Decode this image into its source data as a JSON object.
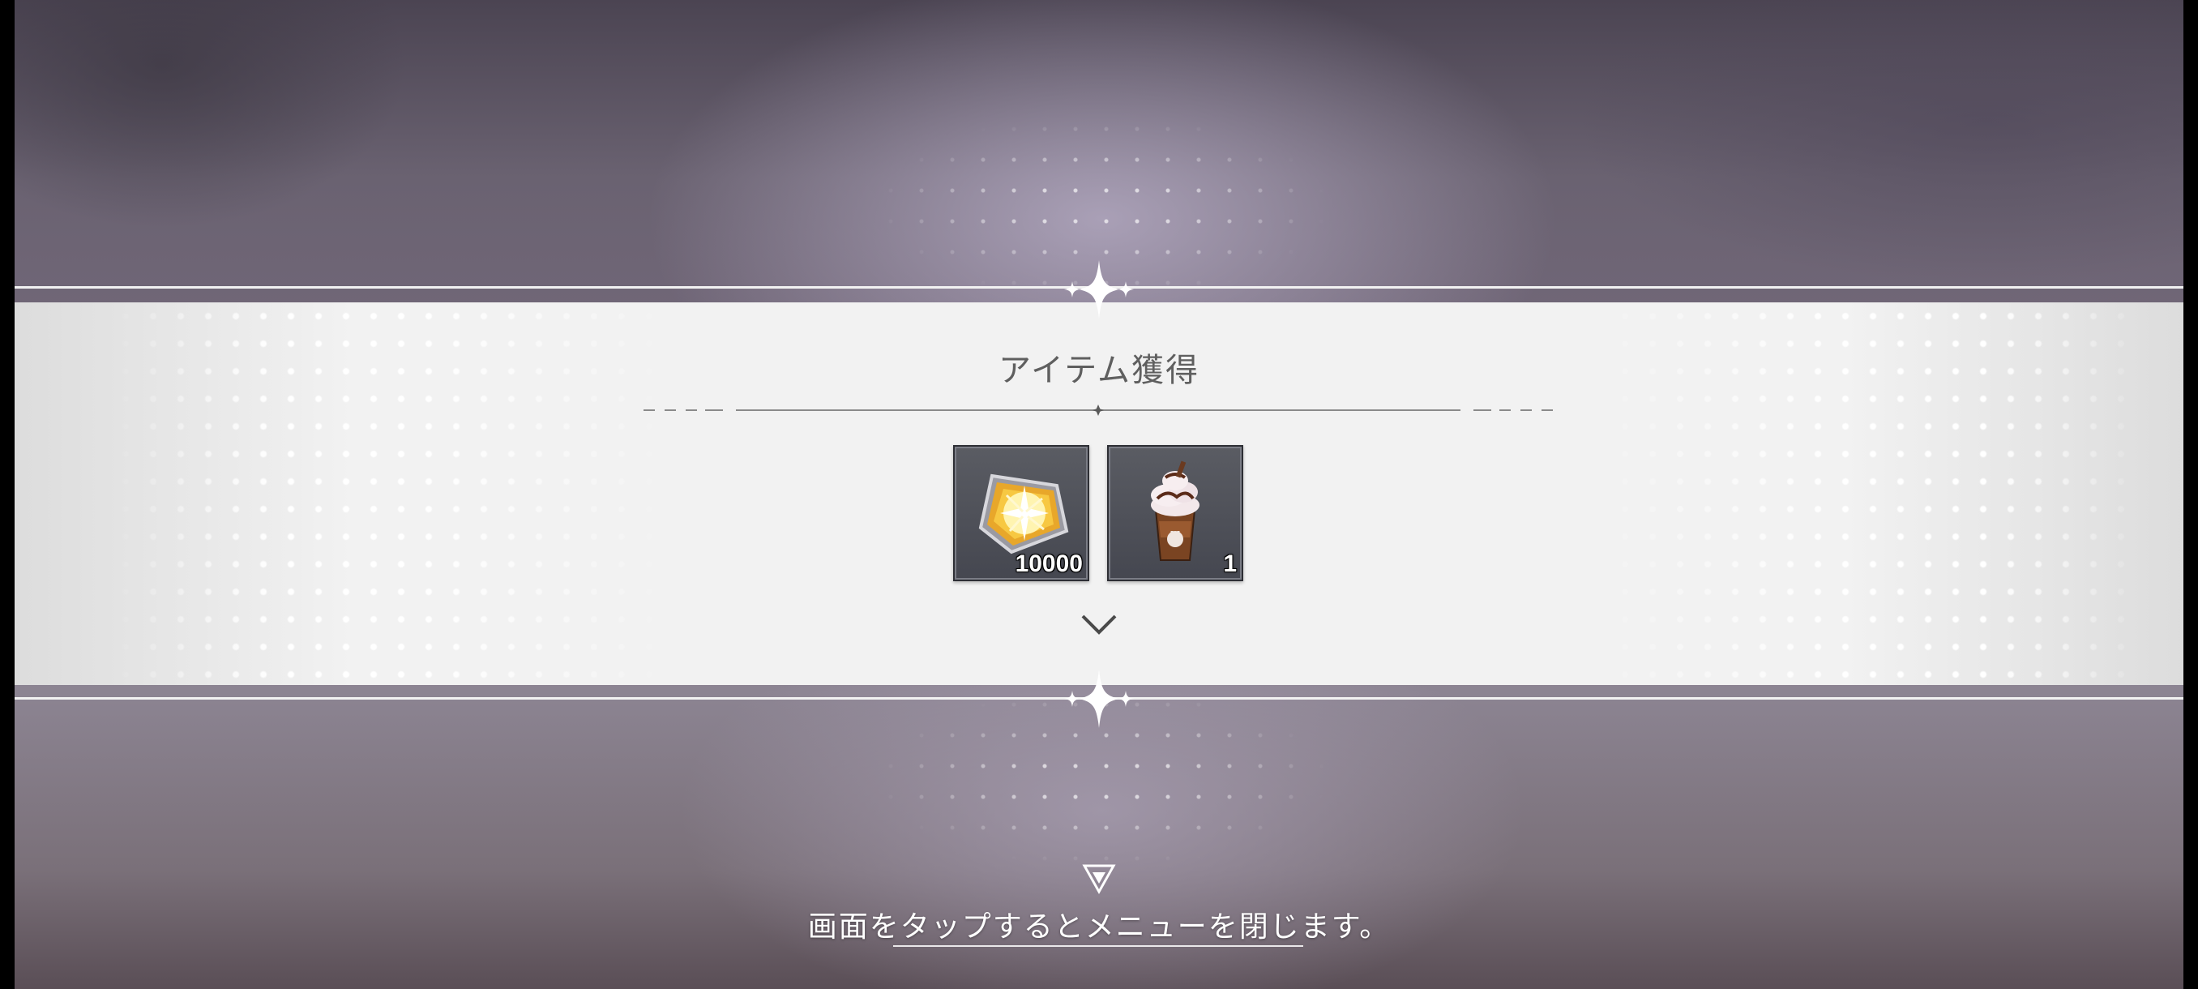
{
  "dialog": {
    "title": "アイテム獲得"
  },
  "items": [
    {
      "icon": "gold-gem-crystal-icon",
      "count": "10000"
    },
    {
      "icon": "chocolate-frappe-drink-icon",
      "count": "1"
    }
  ],
  "footer": {
    "hint": "画面をタップするとメニューを閉じます。"
  },
  "colors": {
    "band": "#f2f2f2",
    "title_text": "#5f5f5f",
    "item_slot": "#4f5159",
    "hint_text": "#ffffff"
  }
}
